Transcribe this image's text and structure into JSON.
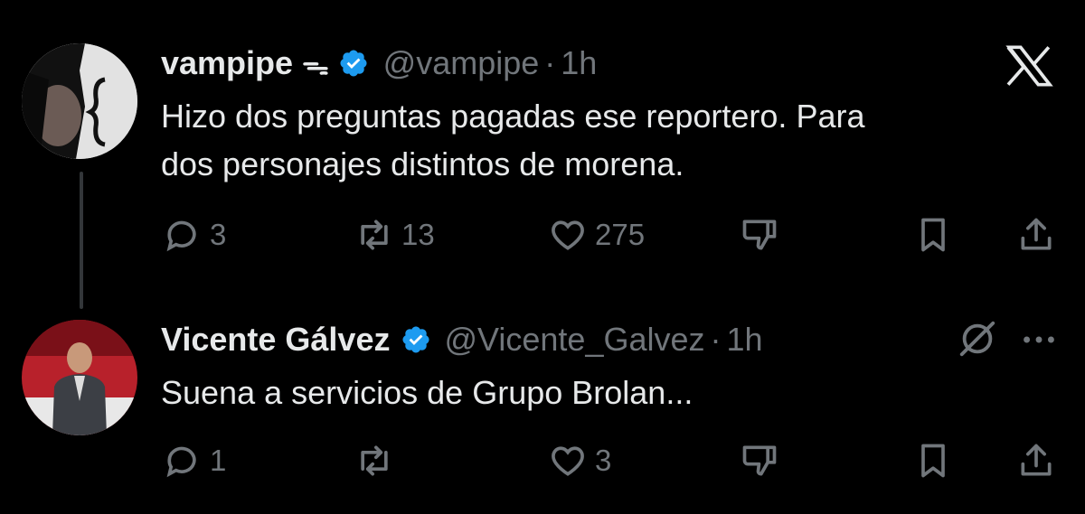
{
  "tweets": [
    {
      "display_name": "vampipe",
      "name_suffix": "ᯓ",
      "handle": "@vampipe",
      "separator": "·",
      "time": "1h",
      "text_line1": "Hizo dos preguntas pagadas ese reportero. Para",
      "text_line2": "dos personajes distintos de morena.",
      "replies": "3",
      "reposts": "13",
      "likes": "275"
    },
    {
      "display_name": "Vicente Gálvez",
      "handle": "@Vicente_Galvez",
      "separator": "·",
      "time": "1h",
      "text": "Suena a servicios de Grupo Brolan...",
      "replies": "1",
      "reposts": "",
      "likes": "3"
    }
  ],
  "colors": {
    "background": "#000000",
    "text": "#e7e9ea",
    "muted": "#71767b",
    "verified": "#1d9bf0"
  },
  "icons": [
    "x-logo-icon",
    "verified-icon",
    "reply-icon",
    "repost-icon",
    "like-icon",
    "dislike-icon",
    "bookmark-icon",
    "share-icon",
    "grok-icon",
    "more-icon"
  ]
}
